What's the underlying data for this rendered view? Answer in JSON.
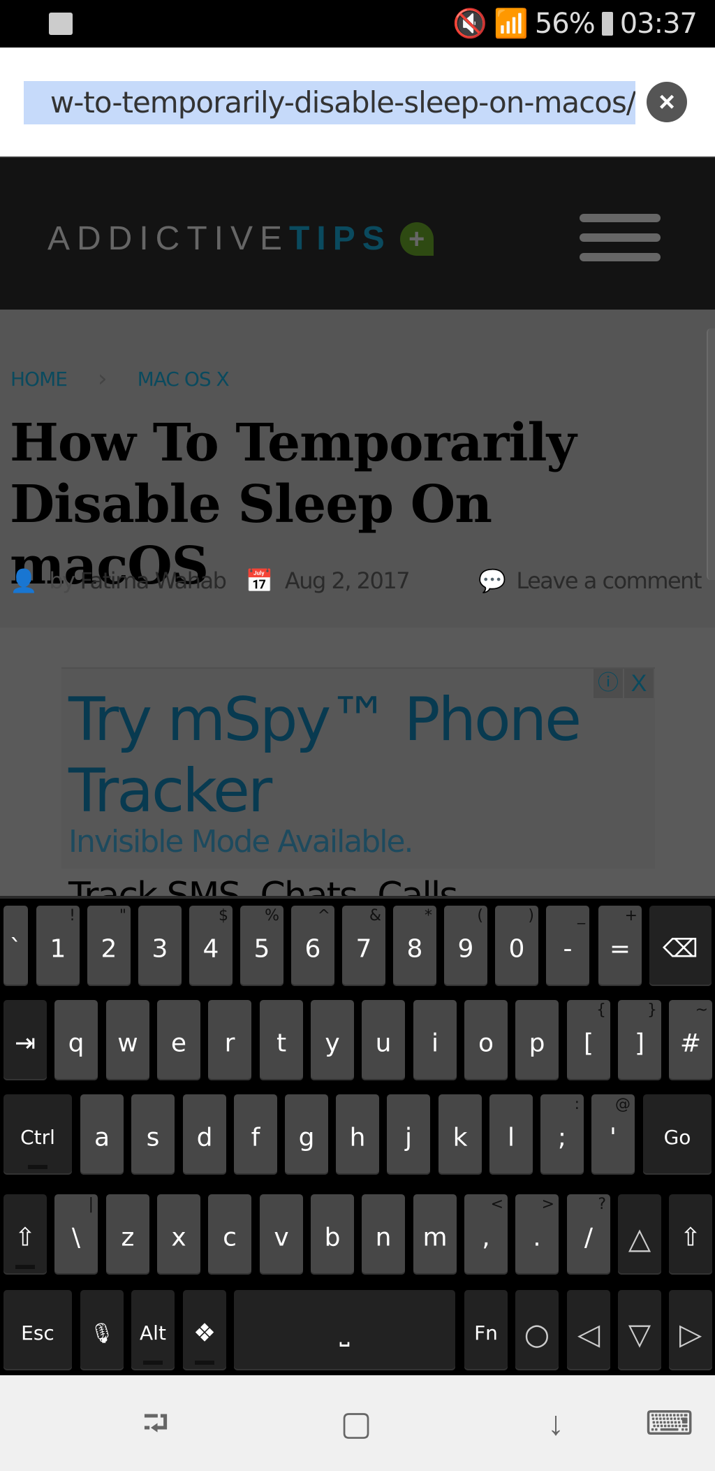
{
  "status_bar": {
    "battery": "56%",
    "time": "03:37",
    "icons": [
      "image-notification-icon",
      "mute-vibrate-icon",
      "wifi-icon",
      "signal-icon",
      "battery-icon"
    ]
  },
  "url_bar": {
    "url": "w-to-temporarily-disable-sleep-on-macos/",
    "clear_icon": "×"
  },
  "site": {
    "logo_part1": "ADDICTIVE",
    "logo_part2": "TIPS",
    "logo_badge": "+",
    "accent": "#0a4a5e"
  },
  "breadcrumb": {
    "home": "HOME",
    "separator": "›",
    "category": "MAC OS X"
  },
  "article": {
    "title": "How To Temporarily Disable Sleep On macOS",
    "by": "by",
    "author": "Fatima Wahab",
    "date": "Aug 2, 2017",
    "comment": "Leave a comment",
    "body_partial": "Track SMS, Chats, Calls"
  },
  "ad": {
    "title": "Try mSpy™ Phone Tracker",
    "subtitle": "Invisible Mode Available.",
    "info": "ⓘ",
    "close": "X"
  },
  "keyboard": {
    "rows": [
      [
        {
          "l": "`",
          "t": "narrow"
        },
        {
          "l": "1",
          "h": "!"
        },
        {
          "l": "2",
          "h": "\""
        },
        {
          "l": "3"
        },
        {
          "l": "4",
          "h": "$"
        },
        {
          "l": "5",
          "h": "%"
        },
        {
          "l": "6",
          "h": "^"
        },
        {
          "l": "7",
          "h": "&"
        },
        {
          "l": "8",
          "h": "*"
        },
        {
          "l": "9",
          "h": "("
        },
        {
          "l": "0",
          "h": ")"
        },
        {
          "l": "-",
          "h": "_"
        },
        {
          "l": "=",
          "h": "+"
        },
        {
          "l": "⌫",
          "t": "mod",
          "n": "backspace"
        }
      ],
      [
        {
          "l": "⇥",
          "t": "mod",
          "n": "tab"
        },
        {
          "l": "q"
        },
        {
          "l": "w"
        },
        {
          "l": "e"
        },
        {
          "l": "r"
        },
        {
          "l": "t"
        },
        {
          "l": "y"
        },
        {
          "l": "u"
        },
        {
          "l": "i"
        },
        {
          "l": "o"
        },
        {
          "l": "p"
        },
        {
          "l": "[",
          "h": "{"
        },
        {
          "l": "]",
          "h": "}"
        },
        {
          "l": "#",
          "h": "~"
        }
      ],
      [
        {
          "l": "Ctrl",
          "t": "mod",
          "n": "ctrl"
        },
        {
          "l": "a"
        },
        {
          "l": "s"
        },
        {
          "l": "d"
        },
        {
          "l": "f"
        },
        {
          "l": "g"
        },
        {
          "l": "h"
        },
        {
          "l": "j"
        },
        {
          "l": "k"
        },
        {
          "l": "l"
        },
        {
          "l": ";",
          "h": ":"
        },
        {
          "l": "'",
          "h": "@"
        },
        {
          "l": "Go",
          "t": "mod",
          "n": "go"
        }
      ],
      [
        {
          "l": "⇧",
          "t": "mod",
          "n": "shift-left"
        },
        {
          "l": "\\",
          "h": "|"
        },
        {
          "l": "z"
        },
        {
          "l": "x"
        },
        {
          "l": "c"
        },
        {
          "l": "v"
        },
        {
          "l": "b"
        },
        {
          "l": "n"
        },
        {
          "l": "m"
        },
        {
          "l": ",",
          "h": "<"
        },
        {
          "l": ".",
          "h": ">"
        },
        {
          "l": "/",
          "h": "?"
        },
        {
          "l": "△",
          "t": "mod",
          "n": "up-arrow"
        },
        {
          "l": "⇧",
          "t": "mod",
          "n": "shift-right"
        }
      ],
      [
        {
          "l": "Esc",
          "t": "mod",
          "n": "esc"
        },
        {
          "l": "🎙",
          "t": "mod",
          "n": "microphone"
        },
        {
          "l": "Alt",
          "t": "mod",
          "n": "alt"
        },
        {
          "l": "❖",
          "t": "mod",
          "n": "dpad"
        },
        {
          "l": "⎵",
          "t": "mod",
          "n": "space"
        },
        {
          "l": "Fn",
          "t": "mod",
          "n": "fn"
        },
        {
          "l": "○",
          "t": "mod",
          "n": "home"
        },
        {
          "l": "◁",
          "t": "mod",
          "n": "left-arrow"
        },
        {
          "l": "▽",
          "t": "mod",
          "n": "down-arrow"
        },
        {
          "l": "▷",
          "t": "mod",
          "n": "right-arrow"
        }
      ]
    ]
  },
  "nav_bar": {
    "recent": "⮒",
    "home": "▢",
    "hide_keyboard": "↓",
    "keyboard": "⌨"
  }
}
